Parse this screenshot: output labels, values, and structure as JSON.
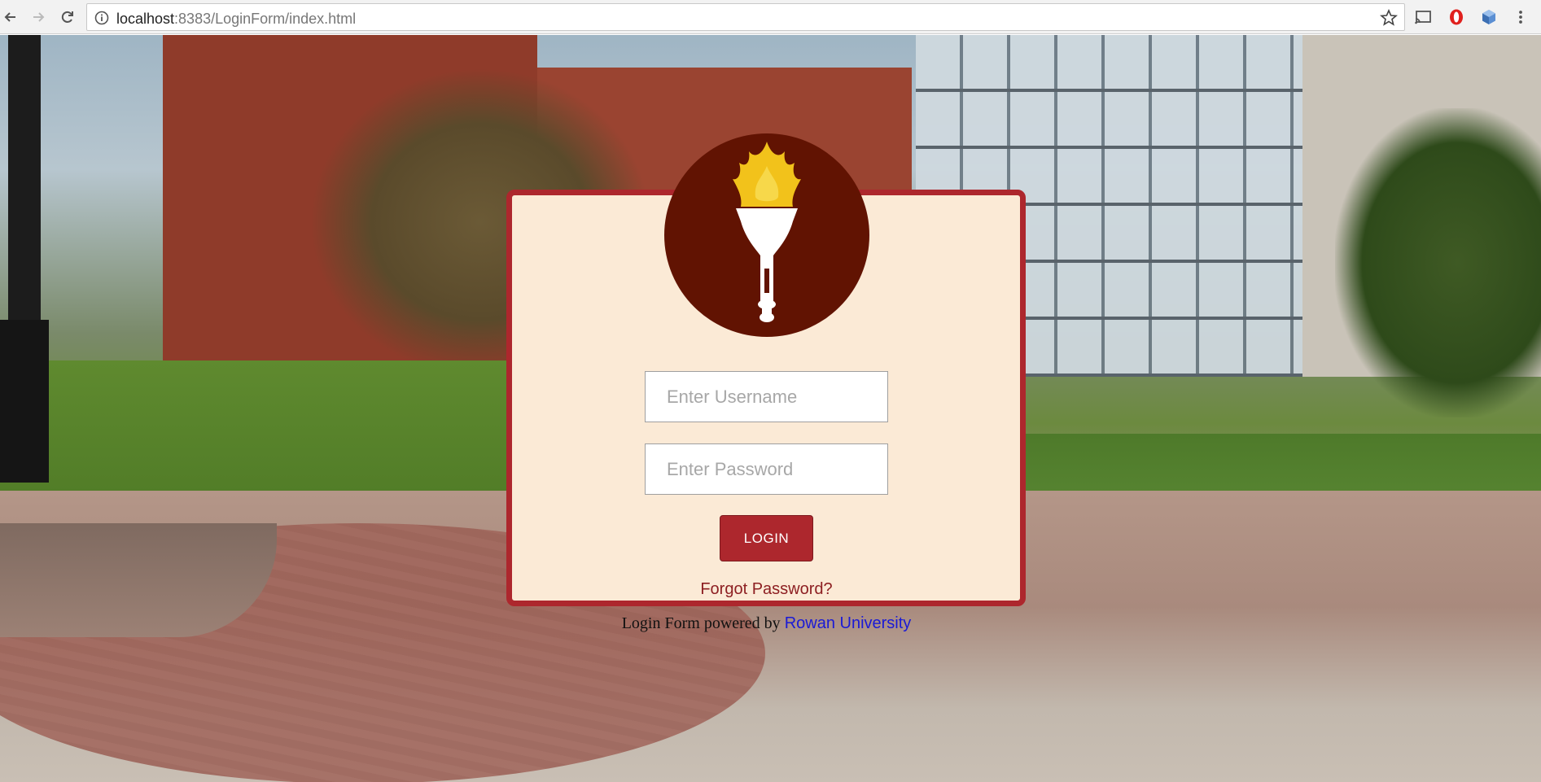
{
  "browser": {
    "url_host": "localhost",
    "url_rest": ":8383/LoginForm/index.html"
  },
  "login": {
    "username_placeholder": "Enter Username",
    "password_placeholder": "Enter Password",
    "login_label": "LOGIN",
    "forgot_label": "Forgot Password?"
  },
  "footer": {
    "prefix": "Login Form powered by ",
    "link_text": "Rowan University"
  },
  "colors": {
    "card_border": "#ad272d",
    "card_background": "#fbead6",
    "logo_circle": "#611302",
    "flame": "#f2c21b",
    "link": "#1a1ad6"
  }
}
